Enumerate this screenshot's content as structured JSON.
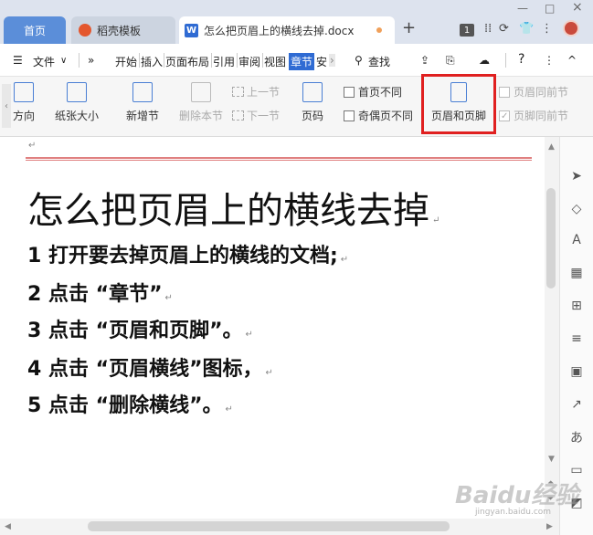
{
  "tabs": {
    "home": "首页",
    "templates": "稻壳模板",
    "document": "怎么把页眉上的横线去掉.docx",
    "add": "+"
  },
  "window": {
    "minimize": "—",
    "maximize": "□",
    "close": "×",
    "badge": "1"
  },
  "menu": {
    "file": "文件",
    "more": "»",
    "tabs": [
      "开始",
      "插入",
      "页面布局",
      "引用",
      "审阅",
      "视图",
      "章节",
      "安"
    ],
    "active_tab": "章节",
    "search": "查找",
    "help": "?",
    "overflow": "⋮",
    "collapse": "^"
  },
  "ribbon": {
    "direction": "方向",
    "paper_size": "纸张大小",
    "new_section": "新增节",
    "delete_section": "删除本节",
    "prev_section": "上一节",
    "next_section": "下一节",
    "page_number": "页码",
    "first_page_diff": "首页不同",
    "odd_even_diff": "奇偶页不同",
    "header_footer": "页眉和页脚",
    "same_as_prev_header": "页眉同前节",
    "same_as_prev_footer": "页脚同前节"
  },
  "document": {
    "title": "怎么把页眉上的横线去掉",
    "lines": [
      "1 打开要去掉页眉上的横线的文档;",
      "2 点击 “章节”",
      "3 点击 “页眉和页脚”。",
      "4 点击 “页眉横线”图标，",
      "5 点击 “删除横线”。"
    ],
    "para_mark": "↵"
  },
  "watermark": {
    "main": "Baidu经验",
    "sub": "jingyan.baidu.com"
  },
  "colors": {
    "accent": "#2f6bd3",
    "highlight": "#e02020",
    "header_rule": "#e08080"
  }
}
